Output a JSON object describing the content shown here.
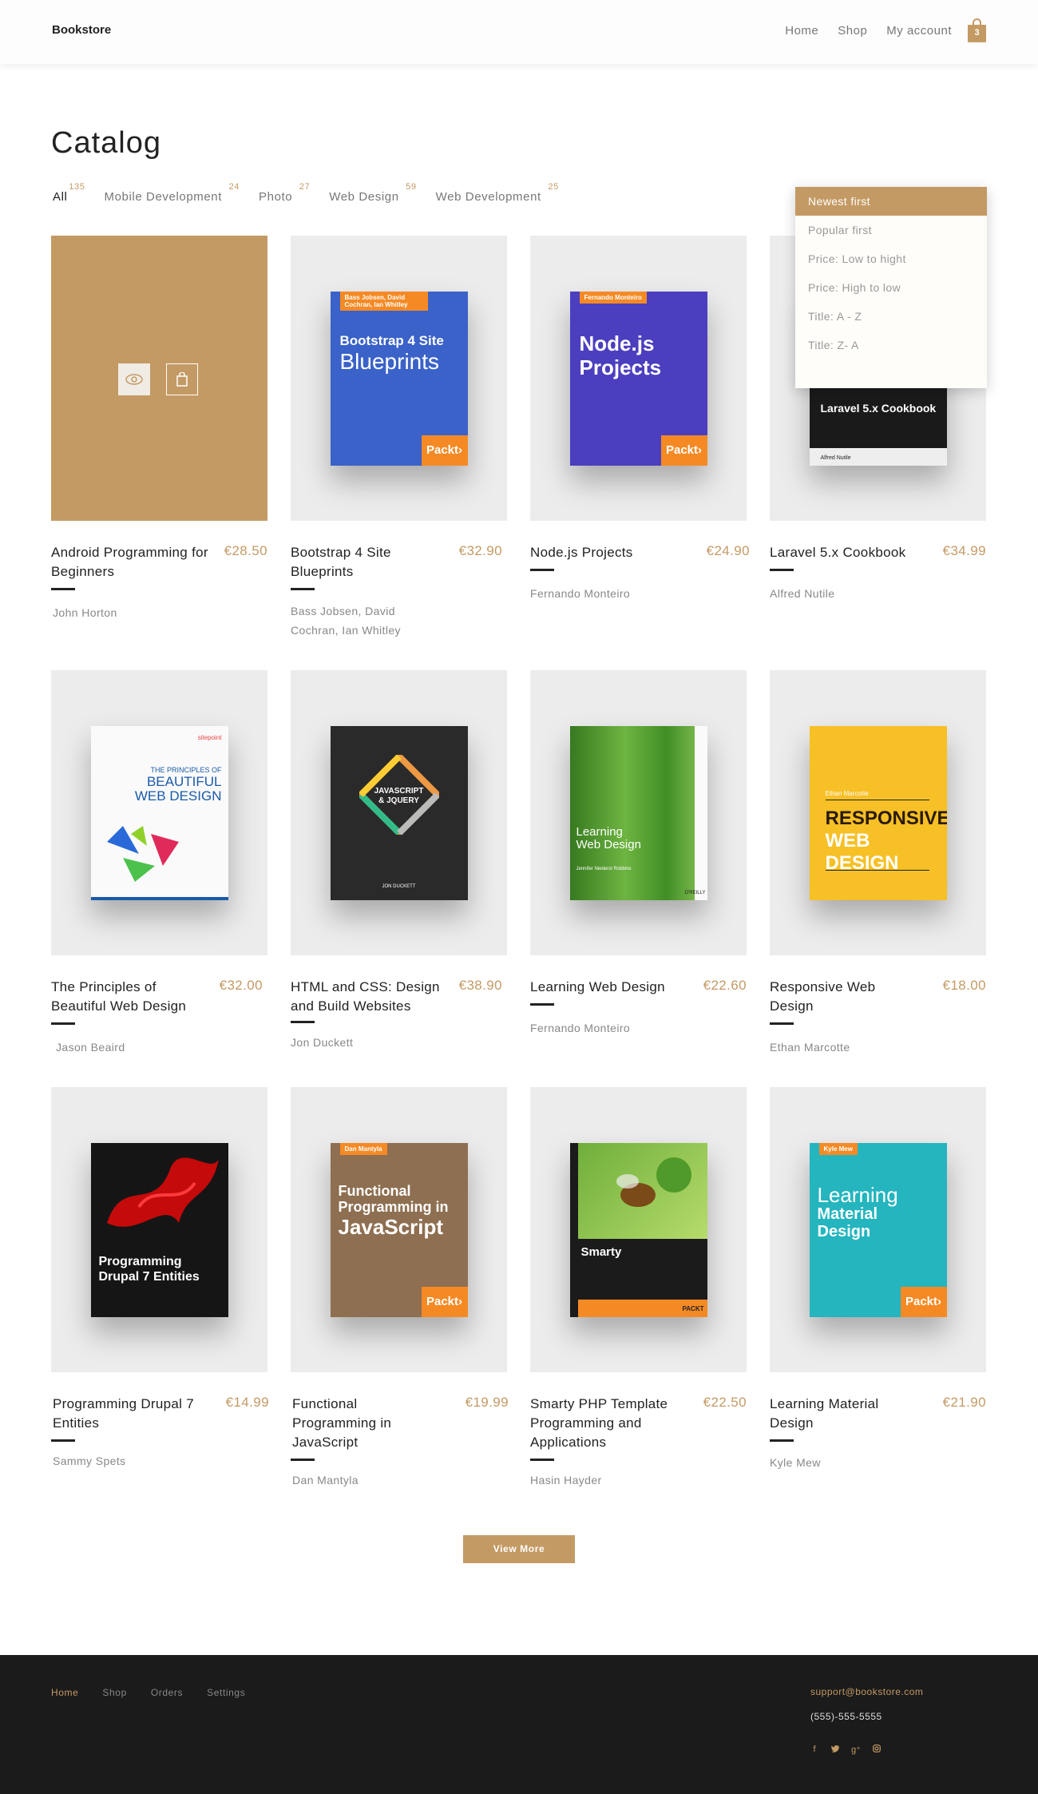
{
  "header": {
    "brand": "Bookstore",
    "nav": [
      "Home",
      "Shop",
      "My account"
    ],
    "cart_count": "3"
  },
  "catalog": {
    "title": "Catalog",
    "filters": [
      {
        "label": "All",
        "count": "135"
      },
      {
        "label": "Mobile Development",
        "count": "24"
      },
      {
        "label": "Photo",
        "count": "27"
      },
      {
        "label": "Web Design",
        "count": "59"
      },
      {
        "label": "Web Development",
        "count": "25"
      }
    ],
    "sort_options": [
      "Newest first",
      "Popular first",
      "Price: Low to hight",
      "Price: High to low",
      "Title: A - Z",
      "Title: Z- A"
    ]
  },
  "products": [
    {
      "title": "Android Programming for Beginners",
      "price": "€28.50",
      "author": "John Horton"
    },
    {
      "title": "Bootstrap 4 Site Blueprints",
      "price": "€32.90",
      "author": "Bass Jobsen, David Cochran, Ian Whitley"
    },
    {
      "title": "Node.js Projects",
      "price": "€24.90",
      "author": "Fernando Monteiro"
    },
    {
      "title": "Laravel 5.x Cookbook",
      "price": "€34.99",
      "author": "Alfred Nutile"
    },
    {
      "title": "The Principles of Beautiful Web Design",
      "price": "€32.00",
      "author": "Jason Beaird"
    },
    {
      "title": "HTML and CSS: Design and Build Websites",
      "price": "€38.90",
      "author": "Jon Duckett"
    },
    {
      "title": "Learning Web Design",
      "price": "€22.60",
      "author": "Fernando Monteiro"
    },
    {
      "title": "Responsive Web Design",
      "price": "€18.00",
      "author": "Ethan Marcotte"
    },
    {
      "title": "Programming Drupal 7 Entities",
      "price": "€14.99",
      "author": "Sammy Spets"
    },
    {
      "title": "Functional Programming in JavaScript",
      "price": "€19.99",
      "author": "Dan Mantyla"
    },
    {
      "title": "Smarty PHP Template Programming and Applications",
      "price": "€22.50",
      "author": "Hasin Hayder"
    },
    {
      "title": "Learning Material Design",
      "price": "€21.90",
      "author": "Kyle Mew"
    }
  ],
  "covers": {
    "boot": {
      "authors": "Bass Jobsen, David Cochran, Ian Whitley",
      "line1": "Bootstrap 4 Site",
      "line2": "Blueprints",
      "publisher": "Packt›"
    },
    "node": {
      "authors": "Fernando Monteiro",
      "line1": "Node.js",
      "line2": "Projects",
      "publisher": "Packt›"
    },
    "lara": {
      "line1": "Laravel 5.x Cookbook",
      "author": "Alfred Nutile"
    },
    "pbwd": {
      "brand": "sitepoint",
      "line1": "THE PRINCIPLES OF",
      "line2": "BEAUTIFUL",
      "line3": "WEB DESIGN"
    },
    "html": {
      "line1": "JAVASCRIPT",
      "line2": "& JQUERY",
      "author": "JON DUCKETT"
    },
    "lwd": {
      "line1": "Learning",
      "line2": "Web Design",
      "author": "Jennifer Niederst Robbins",
      "publisher": "O'REILLY"
    },
    "resp": {
      "author": "Ethan Marcotte",
      "line1": "RESPONSIVE",
      "line2": "WEB DESIGN"
    },
    "drup": {
      "line1": "Programming",
      "line2": "Drupal 7 Entities"
    },
    "func": {
      "authors": "Dan Mantyla",
      "line1": "Functional",
      "line2": "Programming in",
      "line3": "JavaScript",
      "publisher": "Packt›"
    },
    "smar": {
      "line1": "Smarty",
      "publisher": "PACKT"
    },
    "mat": {
      "authors": "Kyle Mew",
      "line1": "Learning",
      "line2": "Material",
      "line3": "Design",
      "publisher": "Packt›"
    }
  },
  "view_more": "View More",
  "footer": {
    "nav": [
      "Home",
      "Shop",
      "Orders",
      "Settings"
    ],
    "email": "support@bookstore.com",
    "phone": "(555)-555-5555",
    "social": [
      "f",
      "t",
      "g+",
      "ig"
    ]
  },
  "colors": {
    "accent": "#c49a64",
    "footer_bg": "#1b1b1b",
    "card_bg": "#ececec"
  }
}
